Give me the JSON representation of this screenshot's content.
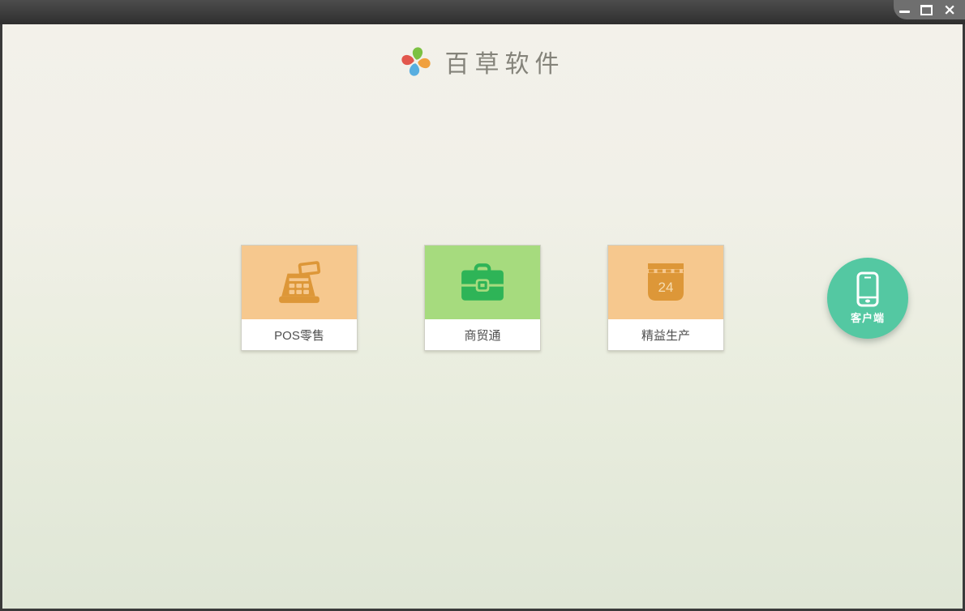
{
  "titlebar": {
    "close_glyph": "×",
    "buttons": [
      {
        "name": "minimize"
      },
      {
        "name": "maximize"
      },
      {
        "name": "close"
      }
    ]
  },
  "header": {
    "app_title": "百草软件"
  },
  "logo": {
    "petals": [
      {
        "position": "top",
        "color": "#7cc142"
      },
      {
        "position": "right",
        "color": "#f0a03e"
      },
      {
        "position": "bottom",
        "color": "#58aee0"
      },
      {
        "position": "left",
        "color": "#e2574d"
      }
    ]
  },
  "products": [
    {
      "label": "POS零售",
      "icon": "cash-register-icon",
      "bg_color": "#f6c88e",
      "icon_color": "#dd9738"
    },
    {
      "label": "商贸通",
      "icon": "briefcase-icon",
      "bg_color": "#a6db7e",
      "icon_color": "#2eb457"
    },
    {
      "label": "精益生产",
      "icon": "calendar-icon",
      "bg_color": "#f6c88e",
      "icon_color": "#dd9738",
      "day": "24"
    }
  ],
  "client": {
    "label": "客户端",
    "icon": "smartphone-icon",
    "bg_color": "#54c8a2"
  }
}
